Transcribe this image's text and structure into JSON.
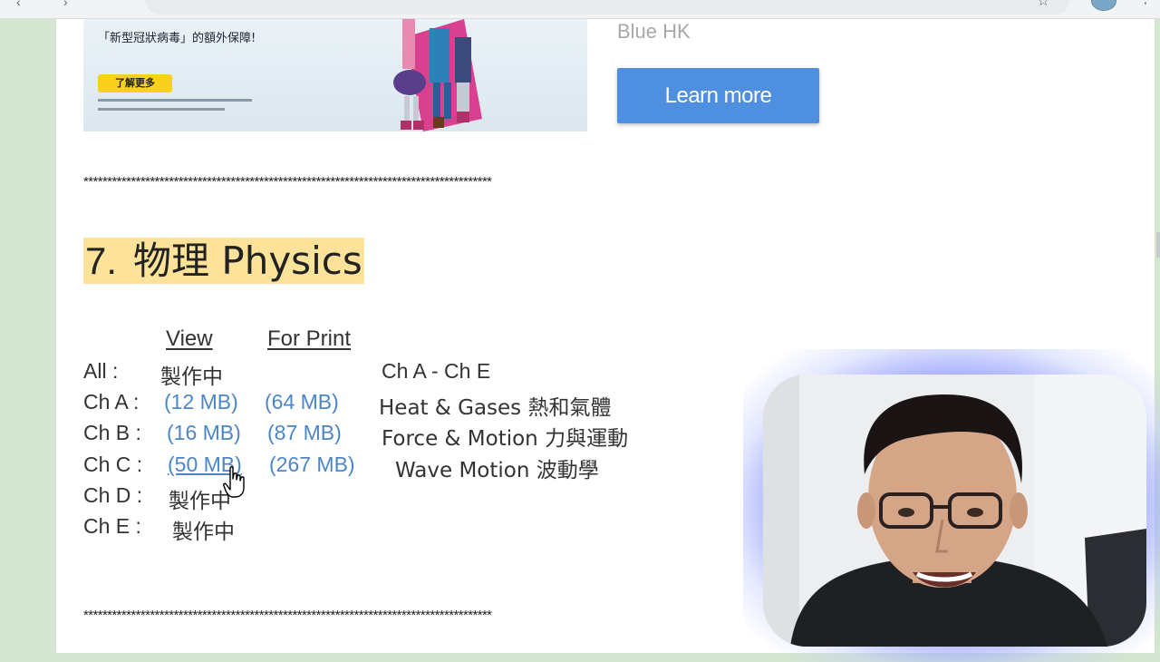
{
  "ad": {
    "headline": "「新型冠狀病毒」的額外保障!",
    "cta": "了解更多",
    "brand": "Blue HK",
    "learn_more": "Learn more"
  },
  "divider": "**************************************************************************************",
  "section": {
    "number": "7.",
    "title": "物理 Physics"
  },
  "columns": {
    "view": "View",
    "print": "For Print"
  },
  "rows": [
    {
      "label": "All :",
      "view": "製作中",
      "print": "",
      "desc": "Ch A - Ch E"
    },
    {
      "label": "Ch A :",
      "view": "(12 MB)",
      "print": "(64 MB)",
      "desc": "Heat & Gases 熱和氣體"
    },
    {
      "label": "Ch B :",
      "view": "(16 MB)",
      "print": "(87 MB)",
      "desc": "Force & Motion 力與運動"
    },
    {
      "label": "Ch C :",
      "view": "(50 MB)",
      "print": "(267 MB)",
      "desc": "Wave Motion 波動學"
    },
    {
      "label": "Ch D :",
      "view": "製作中",
      "print": "",
      "desc": ""
    },
    {
      "label": "Ch E :",
      "view": "製作中",
      "print": "",
      "desc": ""
    }
  ],
  "colors": {
    "link": "#4a86c8",
    "highlight": "#fde39a",
    "button": "#4f8fe0",
    "sidebar": "#d4e6cf"
  },
  "icons": {
    "cursor": "hand-pointer-icon",
    "bookmark": "star-icon",
    "menu": "kebab-menu-icon"
  }
}
